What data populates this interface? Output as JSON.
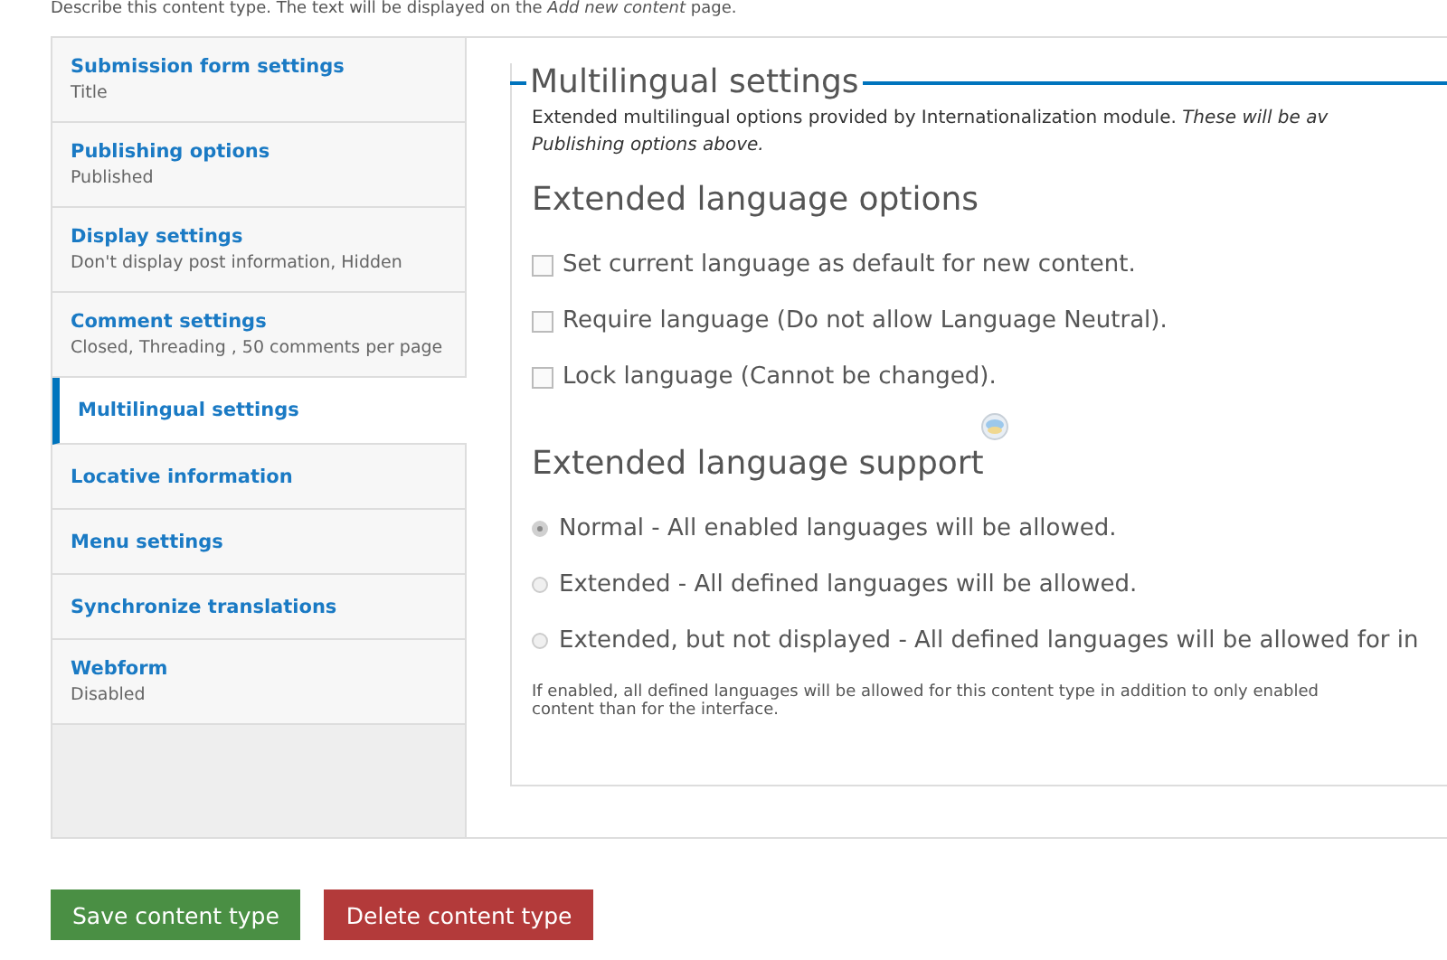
{
  "intro": "Describe this content type. The text will be displayed on the *Add new content* page.",
  "tabs": [
    {
      "title": "Submission form settings",
      "summary": "Title",
      "selected": false
    },
    {
      "title": "Publishing options",
      "summary": "Published",
      "selected": false
    },
    {
      "title": "Display settings",
      "summary": "Don't display post information, Hidden",
      "selected": false
    },
    {
      "title": "Comment settings",
      "summary": "Closed, Threading , 50 comments per page",
      "selected": false
    },
    {
      "title": "Multilingual settings",
      "selected": true
    },
    {
      "title": "Locative information",
      "selected": false
    },
    {
      "title": "Menu settings",
      "selected": false
    },
    {
      "title": "Synchronize translations",
      "selected": false
    },
    {
      "title": "Webform",
      "summary": "Disabled",
      "selected": false
    }
  ],
  "panel": {
    "legend": "Multilingual settings",
    "description": [
      "Extended multilingual options provided by Internationalization module. *These will be av*",
      "Publishing options above."
    ],
    "options_heading": "Extended language options",
    "checkboxes": [
      {
        "label": "Set current language as default for new content.",
        "checked": false
      },
      {
        "label": "Require language (Do not allow Language Neutral).",
        "checked": false
      },
      {
        "label": "Lock language (Cannot be changed).",
        "checked": false
      }
    ],
    "support_heading": "Extended language support",
    "radios": [
      {
        "label": "Normal - All enabled languages will be allowed.",
        "selected": true
      },
      {
        "label": "Extended - All defined languages will be allowed.",
        "selected": false
      },
      {
        "label": "Extended, but not displayed - All defined languages will be allowed for in",
        "selected": false
      }
    ],
    "help": [
      "If enabled, all defined languages will be allowed for this content type in addition to only enabled",
      "content than for the interface."
    ]
  },
  "buttons": [
    {
      "label": "Save content type",
      "kind": "primary"
    },
    {
      "label": "Delete content type",
      "kind": "danger"
    }
  ]
}
